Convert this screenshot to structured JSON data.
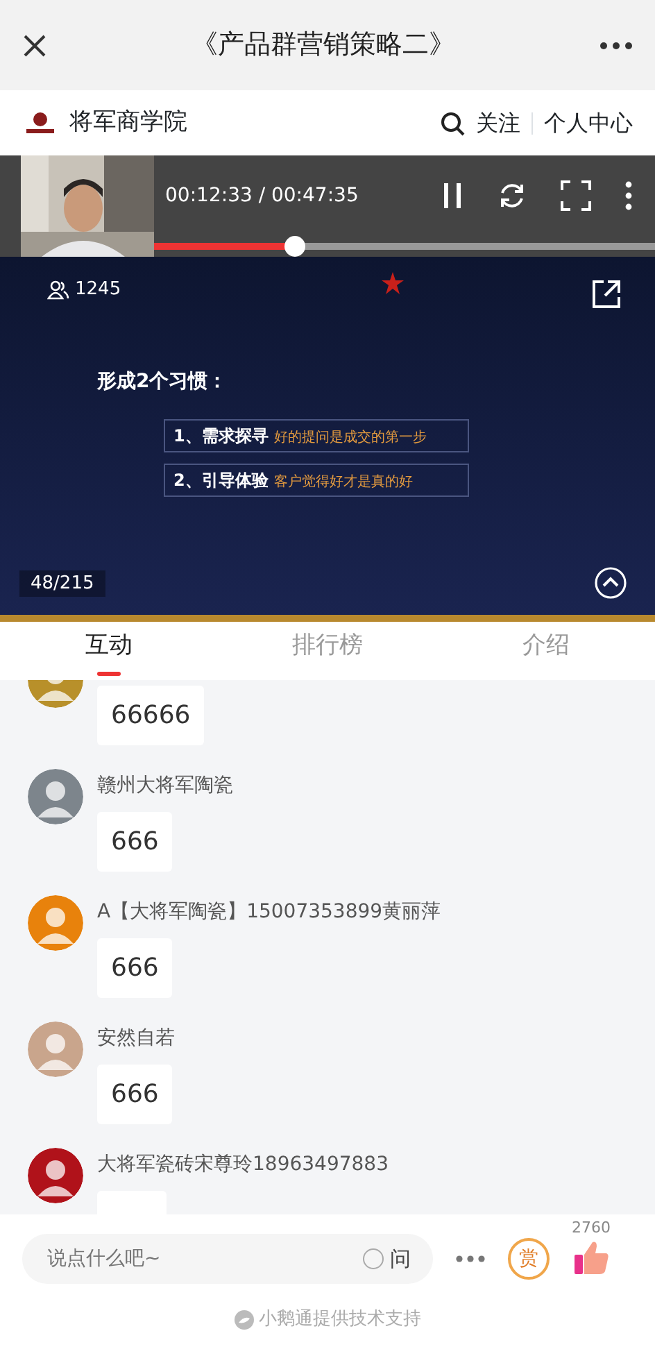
{
  "header": {
    "title": "《产品群营销策略二》"
  },
  "channel": {
    "name": "将军商学院",
    "follow": "关注",
    "profile": "个人中心"
  },
  "player": {
    "time": "00:12:33 / 00:47:35",
    "level": 0.28,
    "viewers": "1245",
    "page": "48/215",
    "slide": {
      "heading": "形成2个习惯：",
      "items": [
        {
          "label": "1、需求探寻",
          "note": "好的提问是成交的第一步"
        },
        {
          "label": "2、引导体验",
          "note": "客户觉得好才是真的好"
        }
      ]
    }
  },
  "tabs": [
    {
      "label": "互动",
      "selected": true
    },
    {
      "label": "排行榜",
      "selected": false
    },
    {
      "label": "介绍",
      "selected": false
    }
  ],
  "comments": [
    {
      "message": "66666",
      "color": "#b8902a"
    },
    {
      "name": "赣州大将军陶瓷",
      "message": "666",
      "color": "#7d858c"
    },
    {
      "name": "A【大将军陶瓷】15007353899黄丽萍",
      "message": "666",
      "color": "#e8820c"
    },
    {
      "name": "安然自若",
      "message": "666",
      "color": "#c9a58c"
    },
    {
      "name": "大将军瓷砖宋尊玲18963497883",
      "color": "#b0121a"
    }
  ],
  "composer": {
    "placeholder": "说点什么吧~",
    "ask": "问",
    "ask_checked": false,
    "likes": "2760",
    "reward": "赏"
  },
  "footer": "小鹅通提供技术支持"
}
